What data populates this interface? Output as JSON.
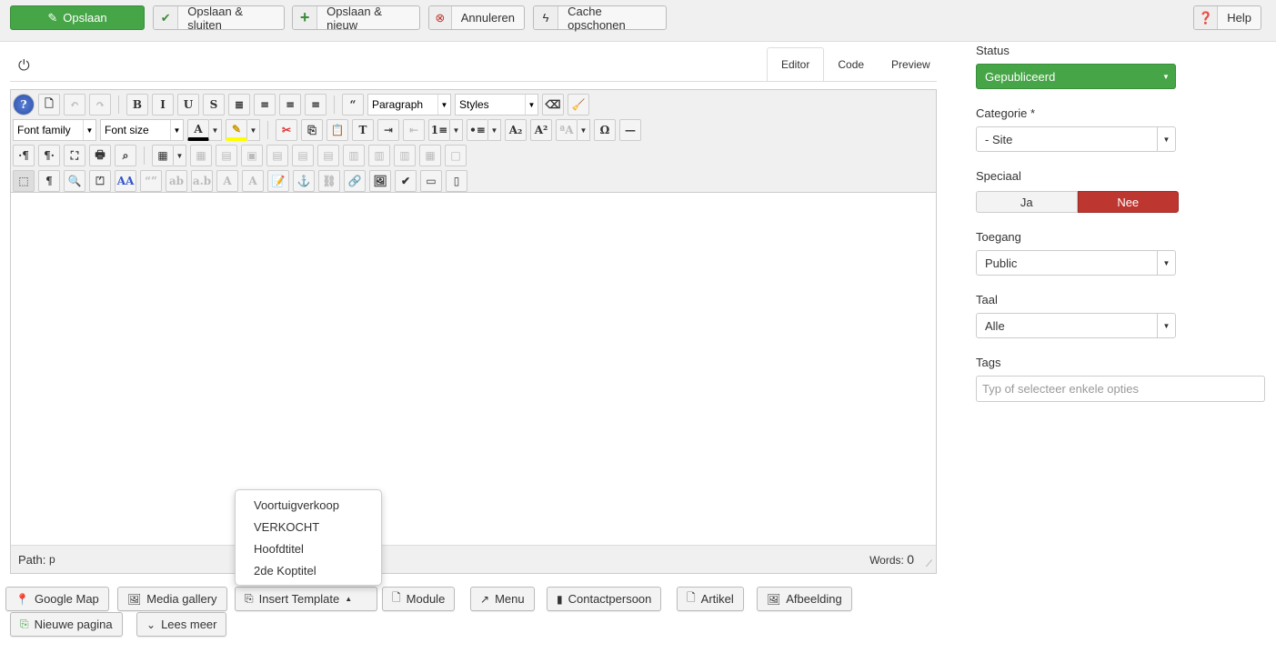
{
  "toolbar": {
    "save": "Opslaan",
    "save_close": "Opslaan & sluiten",
    "save_new": "Opslaan & nieuw",
    "cancel": "Annuleren",
    "clear_cache": "Cache opschonen",
    "help": "Help"
  },
  "colors": {
    "green": "#46a546",
    "red": "#bd362f"
  },
  "editor": {
    "tabs": [
      "Editor",
      "Code",
      "Preview"
    ],
    "active_tab": "Editor",
    "format_select": "Paragraph",
    "styles_select": "Styles",
    "font_family": "Font family",
    "font_size": "Font size",
    "path_label": "Path:",
    "path_value": "p",
    "words_label": "Words:",
    "words_value": "0",
    "rows": [
      [
        {
          "icon": "help-icon",
          "g": "?"
        },
        {
          "icon": "new-document-icon",
          "g": "🗋"
        },
        {
          "icon": "undo-icon",
          "g": "↶",
          "d": true
        },
        {
          "icon": "redo-icon",
          "g": "↷",
          "d": true
        },
        {
          "sep": true
        },
        {
          "icon": "bold-icon",
          "g": "B"
        },
        {
          "icon": "italic-icon",
          "g": "I"
        },
        {
          "icon": "underline-icon",
          "g": "U"
        },
        {
          "icon": "strikethrough-icon",
          "g": "S"
        },
        {
          "icon": "align-justify-icon",
          "g": "≣"
        },
        {
          "icon": "align-center-icon",
          "g": "≡"
        },
        {
          "icon": "align-left-icon",
          "g": "≡"
        },
        {
          "icon": "align-right-icon",
          "g": "≡"
        },
        {
          "sep": true
        },
        {
          "icon": "blockquote-icon",
          "g": "“"
        },
        {
          "select": "format_select",
          "w": 92
        },
        {
          "select": "styles_select",
          "w": 92
        },
        {
          "icon": "eraser-icon",
          "g": "⌫"
        },
        {
          "icon": "clean-broom-icon",
          "g": "🧹"
        }
      ],
      [
        {
          "select": "font_family",
          "w": 92
        },
        {
          "select": "font_size",
          "w": 92
        },
        {
          "icon": "text-color-icon",
          "g": "A",
          "a": true
        },
        {
          "icon": "highlight-color-icon",
          "g": "✎",
          "a": true
        },
        {
          "sep": true
        },
        {
          "icon": "cut-icon",
          "g": "✂"
        },
        {
          "icon": "copy-icon",
          "g": "⎘"
        },
        {
          "icon": "paste-icon",
          "g": "📋"
        },
        {
          "icon": "paste-text-icon",
          "g": "T"
        },
        {
          "icon": "indent-icon",
          "g": "⇥"
        },
        {
          "icon": "outdent-icon",
          "g": "⇤",
          "d": true
        },
        {
          "icon": "ordered-list-icon",
          "g": "1≡",
          "a": true
        },
        {
          "icon": "unordered-list-icon",
          "g": "•≡",
          "a": true
        },
        {
          "icon": "subscript-icon",
          "g": "A₂"
        },
        {
          "icon": "superscript-icon",
          "g": "A²"
        },
        {
          "icon": "font-size-icon",
          "g": "ªA",
          "d": true,
          "a": true
        },
        {
          "icon": "special-char-icon",
          "g": "Ω"
        },
        {
          "icon": "horizontal-rule-icon",
          "g": "—"
        }
      ],
      [
        {
          "icon": "ltr-icon",
          "g": "·¶"
        },
        {
          "icon": "rtl-icon",
          "g": "¶·"
        },
        {
          "icon": "fullscreen-icon",
          "g": "⛶"
        },
        {
          "icon": "print-icon",
          "g": "🖶"
        },
        {
          "icon": "search-replace-icon",
          "g": "⌕"
        },
        {
          "sep": true
        },
        {
          "icon": "table-icon",
          "g": "▦",
          "a": true
        },
        {
          "icon": "delete-table-icon",
          "g": "▦",
          "d": true
        },
        {
          "icon": "row-props-icon",
          "g": "▤",
          "d": true
        },
        {
          "icon": "cell-props-icon",
          "g": "▣",
          "d": true
        },
        {
          "icon": "insert-row-before-icon",
          "g": "▤",
          "d": true
        },
        {
          "icon": "insert-row-after-icon",
          "g": "▤",
          "d": true
        },
        {
          "icon": "delete-row-icon",
          "g": "▤",
          "d": true
        },
        {
          "icon": "insert-col-before-icon",
          "g": "▥",
          "d": true
        },
        {
          "icon": "insert-col-after-icon",
          "g": "▥",
          "d": true
        },
        {
          "icon": "delete-col-icon",
          "g": "▥",
          "d": true
        },
        {
          "icon": "split-cells-icon",
          "g": "▦",
          "d": true
        },
        {
          "icon": "merge-cells-icon",
          "g": "□",
          "d": true
        }
      ],
      [
        {
          "icon": "visual-aid-icon",
          "g": "⬚",
          "act": true
        },
        {
          "icon": "show-blocks-icon",
          "g": "¶"
        },
        {
          "icon": "preview-icon",
          "g": "🔍"
        },
        {
          "icon": "pagebreak-icon",
          "g": "⏍"
        },
        {
          "icon": "style-icon",
          "g": "AA"
        },
        {
          "icon": "cite-icon",
          "g": "“”",
          "d": true
        },
        {
          "icon": "abbr-icon",
          "g": "ab",
          "d": true
        },
        {
          "icon": "acronym-icon",
          "g": "a.b",
          "d": true
        },
        {
          "icon": "del-icon",
          "g": "A",
          "d": true
        },
        {
          "icon": "ins-icon",
          "g": "A",
          "d": true
        },
        {
          "icon": "attributes-icon",
          "g": "📝"
        },
        {
          "icon": "anchor-icon",
          "g": "⚓"
        },
        {
          "icon": "unlink-icon",
          "g": "⛓",
          "d": true
        },
        {
          "icon": "link-icon",
          "g": "🔗"
        },
        {
          "icon": "image-icon",
          "g": "🖼"
        },
        {
          "icon": "spellcheck-icon",
          "g": "✔"
        },
        {
          "icon": "layer-icon",
          "g": "▭"
        },
        {
          "icon": "template-icon",
          "g": "▯"
        }
      ]
    ]
  },
  "template_menu": [
    "Voortuigverkoop",
    "VERKOCHT",
    "Hoofdtitel",
    "2de Koptitel"
  ],
  "buttons": {
    "google_map": "Google Map",
    "media_gallery": "Media gallery",
    "insert_template": "Insert Template",
    "module": "Module",
    "menu": "Menu",
    "contact": "Contactpersoon",
    "article": "Artikel",
    "image": "Afbeelding",
    "new_page": "Nieuwe pagina",
    "read_more": "Lees meer"
  },
  "sidebar": {
    "status_label": "Status",
    "status_value": "Gepubliceerd",
    "category_label": "Categorie *",
    "category_value": "- Site",
    "featured_label": "Speciaal",
    "featured_yes": "Ja",
    "featured_no": "Nee",
    "featured_selected": "Nee",
    "access_label": "Toegang",
    "access_value": "Public",
    "language_label": "Taal",
    "language_value": "Alle",
    "tags_label": "Tags",
    "tags_placeholder": "Typ of selecteer enkele opties"
  }
}
